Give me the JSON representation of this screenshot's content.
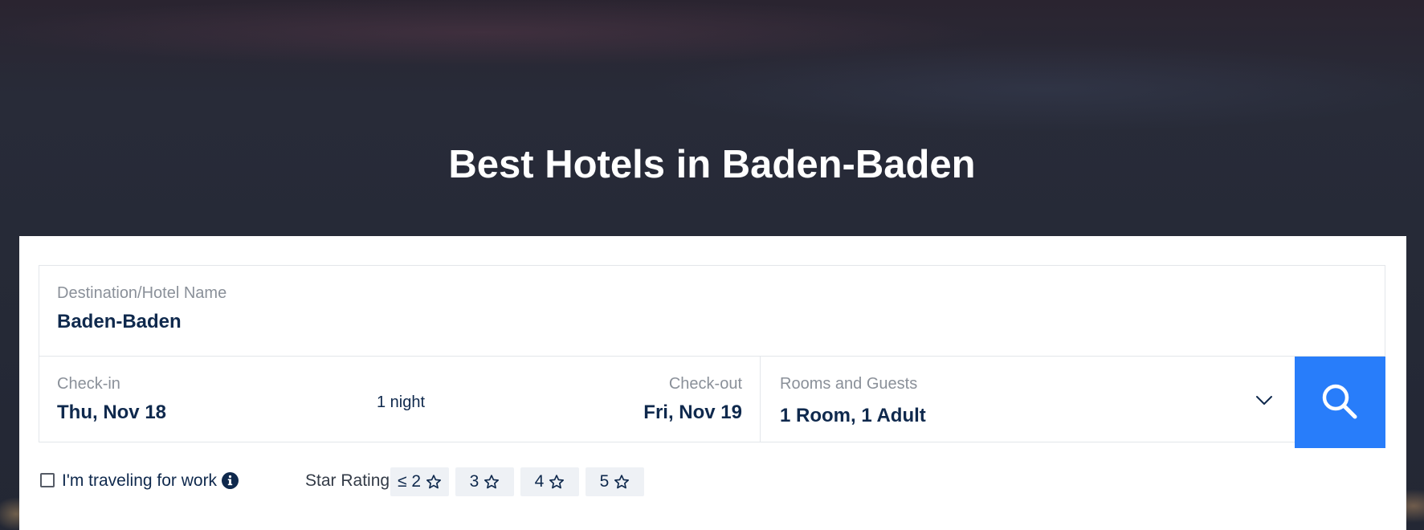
{
  "hero": {
    "title": "Best Hotels in Baden-Baden"
  },
  "search": {
    "destination": {
      "label": "Destination/Hotel Name",
      "value": "Baden-Baden"
    },
    "check_in": {
      "label": "Check-in",
      "value": "Thu, Nov 18"
    },
    "nights": "1 night",
    "check_out": {
      "label": "Check-out",
      "value": "Fri, Nov 19"
    },
    "rooms_guests": {
      "label": "Rooms and Guests",
      "value": "1 Room, 1 Adult",
      "icon": "chevron-down-icon"
    },
    "search_button_icon": "search-icon"
  },
  "options": {
    "work_travel": {
      "label": "I'm traveling for work",
      "checked": false,
      "icon": "info-icon"
    },
    "star_rating": {
      "label": "Star Rating",
      "chips": [
        "≤ 2",
        "3",
        "4",
        "5"
      ],
      "icon": "star-outline-icon"
    }
  },
  "colors": {
    "accent": "#287dfa",
    "text_dark": "#0f294d",
    "text_muted": "#8a9099",
    "chip_bg": "#eef1f5"
  }
}
